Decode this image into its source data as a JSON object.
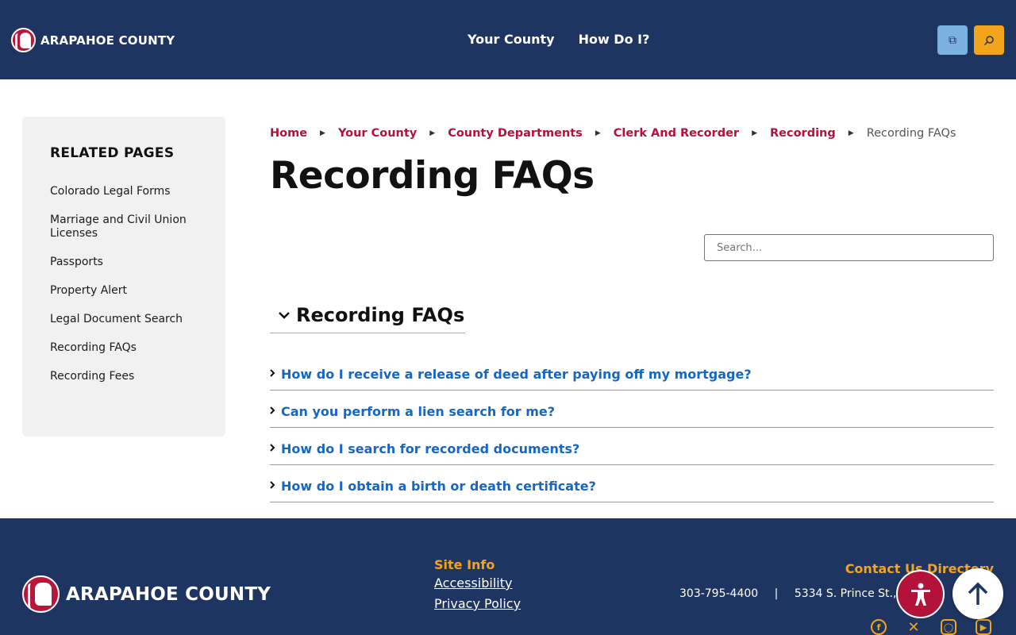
{
  "header": {
    "logo_text": "ARAPAHOE COUNTY",
    "nav": [
      "Your County",
      "How Do I?"
    ],
    "translate_icon": "translate-icon",
    "search_icon": "search-icon"
  },
  "sidebar": {
    "title": "RELATED PAGES",
    "items": [
      "Colorado Legal Forms",
      "Marriage and Civil Union Licenses",
      "Passports",
      "Property Alert",
      "Legal Document Search",
      "Recording FAQs",
      "Recording Fees"
    ]
  },
  "breadcrumb": [
    "Home",
    "Your County",
    "County Departments",
    "Clerk And Recorder",
    "Recording",
    "Recording FAQs"
  ],
  "page_title": "Recording FAQs",
  "search": {
    "placeholder": "Search..."
  },
  "faq": {
    "section_title": "Recording FAQs",
    "items": [
      "How do I receive a release of deed after paying off my mortgage?",
      "Can you perform a lien search for me?",
      "How do I search for recorded documents?",
      "How do I obtain a birth or death certificate?"
    ]
  },
  "footer": {
    "logo_text": "ARAPAHOE COUNTY",
    "site_info_title": "Site Info",
    "site_info_links": [
      "Accessibility",
      "Privacy Policy"
    ],
    "contact_title": "Contact Us Directory",
    "phone": "303-795-4400",
    "separator": "|",
    "address": "5334 S. Prince St., Li"
  },
  "colors": {
    "navy": "#1f3561",
    "crimson": "#b3123b",
    "gold": "#f2a51c",
    "link_blue": "#1766c2"
  }
}
